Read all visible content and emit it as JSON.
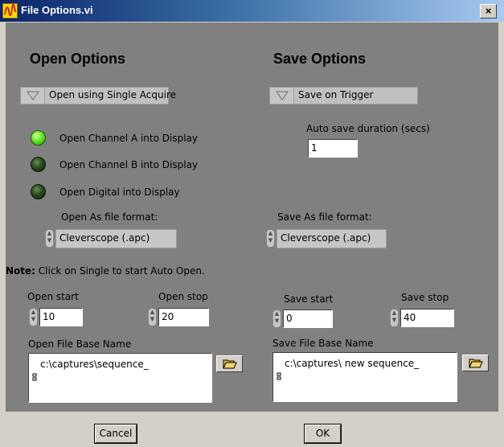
{
  "window": {
    "title": "File Options.vi",
    "close_glyph": "×",
    "icon": "labview-vi-icon"
  },
  "open": {
    "heading": "Open Options",
    "mode": "Open using Single Acquire",
    "channels": [
      {
        "label": "Open Channel A into Display",
        "on": true
      },
      {
        "label": "Open Channel B into Display",
        "on": false
      },
      {
        "label": "Open Digital into Display",
        "on": false
      }
    ],
    "format_label": "Open As file format:",
    "format_value": "Cleverscope (.apc)",
    "start_label": "Open start",
    "start_value": "10",
    "stop_label": "Open stop",
    "stop_value": "20",
    "base_name_label": "Open File Base Name",
    "base_name_value": "c:\\captures\\sequence_"
  },
  "save": {
    "heading": "Save Options",
    "mode": "Save on Trigger",
    "duration_label": "Auto save duration (secs)",
    "duration_value": "1",
    "format_label": "Save As file format:",
    "format_value": "Cleverscope (.apc)",
    "start_label": "Save start",
    "start_value": "0",
    "stop_label": "Save stop",
    "stop_value": "40",
    "base_name_label": "Save File Base Name",
    "base_name_value": "c:\\captures\\ new sequence_"
  },
  "note": {
    "prefix": "Note:",
    "text": " Click on Single to start Auto Open."
  },
  "buttons": {
    "cancel": "Cancel",
    "ok": "OK"
  },
  "colors": {
    "panel": "#808080",
    "led_on": "#6cf028",
    "led_off": "#294a1c"
  }
}
